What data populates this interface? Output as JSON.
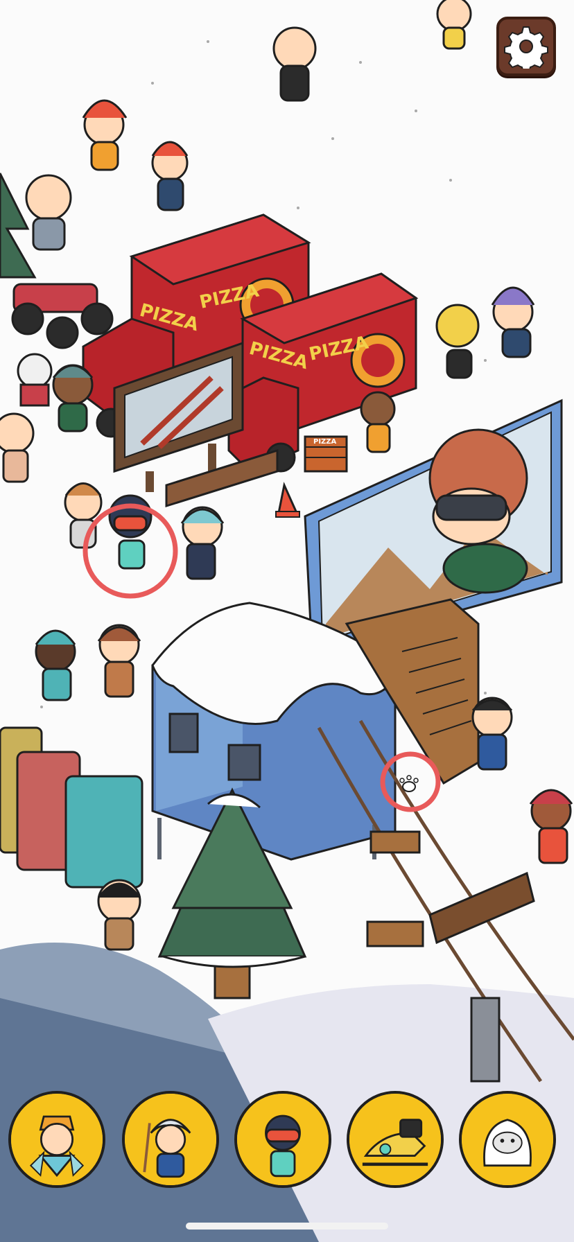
{
  "scene": {
    "truck_1": {
      "side_label_a": "PIZZA",
      "side_label_b": "PIZZA"
    },
    "truck_2": {
      "side_label_a": "PIZZA",
      "side_label_b": "PIZZA"
    },
    "pizza_box_label": "PIZZA",
    "found_markers": [
      {
        "target": "skier-with-goggles",
        "color": "#e85a5a"
      },
      {
        "target": "paw-print",
        "color": "#e85a5a"
      }
    ]
  },
  "hud": {
    "settings_icon": "gear-icon",
    "accent_color": "#f6c21c"
  },
  "targets": [
    {
      "name": "ice-queen",
      "icon": "ice-queen-icon"
    },
    {
      "name": "frost-boy",
      "icon": "frost-boy-icon"
    },
    {
      "name": "goggle-skier",
      "icon": "goggle-skier-icon"
    },
    {
      "name": "snowmobile",
      "icon": "snowmobile-icon"
    },
    {
      "name": "yeti",
      "icon": "yeti-icon"
    }
  ]
}
